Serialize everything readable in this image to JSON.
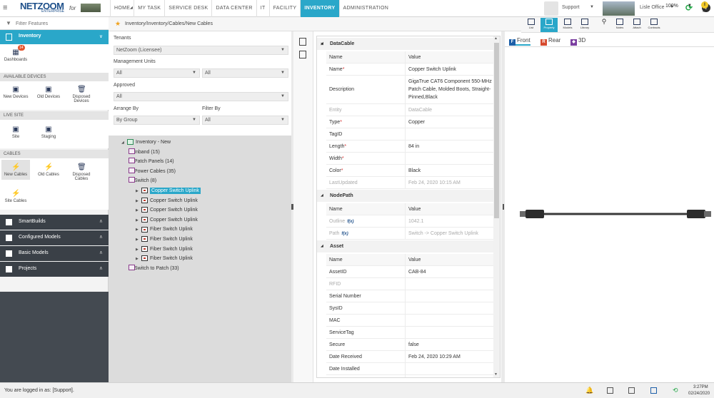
{
  "topbar": {
    "logo": "NETZOOM",
    "logo_sub": "ENTERPRISE",
    "logo_for": "for",
    "nav_tabs": [
      {
        "label": "HOME"
      },
      {
        "label": "MY TASK"
      },
      {
        "label": "SERVICE DESK"
      },
      {
        "label": "DATA CENTER"
      },
      {
        "label": "IT"
      },
      {
        "label": "FACILITY"
      },
      {
        "label": "INVENTORY"
      },
      {
        "label": "ADMINISTRATION"
      }
    ],
    "user": "Support",
    "office": "Lisle Office"
  },
  "sidebar": {
    "filter_placeholder": "Filter Features",
    "inventory_label": "Inventory",
    "dashboards_label": "Dashboards",
    "dashboards_badge": "14",
    "available_devices_title": "AVAILABLE DEVICES",
    "devices": [
      {
        "label": "New Devices"
      },
      {
        "label": "Old Devices"
      },
      {
        "label": "Disposed Devices"
      }
    ],
    "live_site_title": "LIVE SITE",
    "live_site": [
      {
        "label": "Site"
      },
      {
        "label": "Staging"
      }
    ],
    "cables_title": "CABLES",
    "cables": [
      {
        "label": "New Cables"
      },
      {
        "label": "Old Cables"
      },
      {
        "label": "Disposed Cables"
      },
      {
        "label": "Site Cables"
      }
    ],
    "modules": [
      {
        "label": "SmartBuilds"
      },
      {
        "label": "Configured Models"
      },
      {
        "label": "Basic Models"
      },
      {
        "label": "Projects"
      }
    ]
  },
  "breadcrumb": "Inventory/Inventory/Cables/New Cables",
  "toolbar": {
    "buttons": [
      {
        "label": "List"
      },
      {
        "label": "Property"
      },
      {
        "label": "Models"
      },
      {
        "label": "Library"
      },
      {
        "label": "Notes"
      },
      {
        "label": "Attach"
      },
      {
        "label": "Contracts"
      }
    ],
    "zoom": "100%",
    "info_label": "Info"
  },
  "form": {
    "tenants_label": "Tenants",
    "tenants_value": "NetZoom (Licensee)",
    "mgmt_label": "Management Units",
    "mgmt_value_1": "All",
    "mgmt_value_2": "All",
    "approved_label": "Approved",
    "approved_value": "All",
    "arrange_label": "Arrange By",
    "arrange_value": "By Group",
    "filter_label": "Filter By",
    "filter_value": "All"
  },
  "tree": [
    {
      "label": "Inventory - New",
      "indent": 0,
      "toggle": "◢",
      "kind": "root"
    },
    {
      "label": "Inband (15)",
      "indent": 1,
      "toggle": "▶",
      "kind": "grp"
    },
    {
      "label": "Patch Panels (14)",
      "indent": 1,
      "toggle": "▶",
      "kind": "grp"
    },
    {
      "label": "Power Cables (35)",
      "indent": 1,
      "toggle": "▶",
      "kind": "grp"
    },
    {
      "label": "Switch (8)",
      "indent": 1,
      "toggle": "◢",
      "kind": "grp"
    },
    {
      "label": "Copper Switch Uplink",
      "indent": 2,
      "toggle": "▶",
      "kind": "cab",
      "selected": true
    },
    {
      "label": "Copper Switch Uplink",
      "indent": 2,
      "toggle": "▶",
      "kind": "cab"
    },
    {
      "label": "Copper Switch Uplink",
      "indent": 2,
      "toggle": "▶",
      "kind": "cab"
    },
    {
      "label": "Copper Switch Uplink",
      "indent": 2,
      "toggle": "▶",
      "kind": "cab"
    },
    {
      "label": "Fiber Switch Uplink",
      "indent": 2,
      "toggle": "▶",
      "kind": "cab"
    },
    {
      "label": "Fiber Switch Uplink",
      "indent": 2,
      "toggle": "▶",
      "kind": "cab"
    },
    {
      "label": "Fiber Switch Uplink",
      "indent": 2,
      "toggle": "▶",
      "kind": "cab"
    },
    {
      "label": "Fiber Switch Uplink",
      "indent": 2,
      "toggle": "▶",
      "kind": "cab"
    },
    {
      "label": "Switch to Patch (33)",
      "indent": 1,
      "toggle": "▶",
      "kind": "grp"
    }
  ],
  "props": {
    "groups": [
      {
        "name": "DataCable",
        "rows": [
          {
            "k": "Name",
            "v": "Value",
            "hdr": true
          },
          {
            "k": "Name",
            "v": "Copper Switch Uplink",
            "req": true
          },
          {
            "k": "Description",
            "v": "GigaTrue CAT6 Component 550-MHz Patch Cable, Molded Boots, Straight-Pinned,Black",
            "tall": true
          },
          {
            "k": "Entity",
            "v": "DataCable",
            "dim": true
          },
          {
            "k": "Type",
            "v": "Copper",
            "req": true
          },
          {
            "k": "TagID",
            "v": ""
          },
          {
            "k": "Length",
            "v": "84 in",
            "req": true
          },
          {
            "k": "Width",
            "v": "",
            "req": true
          },
          {
            "k": "Color",
            "v": "Black",
            "req": true
          },
          {
            "k": "LastUpdated",
            "v": "Feb 24, 2020 10:15 AM",
            "dim": true
          }
        ]
      },
      {
        "name": "NodePath",
        "rows": [
          {
            "k": "Name",
            "v": "Value",
            "hdr": true
          },
          {
            "k": "Outline",
            "v": "1042.1",
            "dim": true,
            "fx": true
          },
          {
            "k": "Path",
            "v": "Switch -> Copper Switch Uplink",
            "dim": true,
            "fx": true
          }
        ]
      },
      {
        "name": "Asset",
        "rows": [
          {
            "k": "Name",
            "v": "Value",
            "hdr": true
          },
          {
            "k": "AssetID",
            "v": "CAB-84"
          },
          {
            "k": "RFID",
            "v": "",
            "dim": true
          },
          {
            "k": "Serial Number",
            "v": ""
          },
          {
            "k": "SysID",
            "v": ""
          },
          {
            "k": "MAC",
            "v": ""
          },
          {
            "k": "ServiceTag",
            "v": ""
          },
          {
            "k": "Secure",
            "v": "false"
          },
          {
            "k": "Date Received",
            "v": "Feb 24, 2020 10:29 AM"
          },
          {
            "k": "Date Installed",
            "v": ""
          },
          {
            "k": "Date Uninstalled",
            "v": ""
          }
        ]
      }
    ],
    "fx_label": "f(x)"
  },
  "viewer": {
    "tabs": [
      {
        "label": "Front"
      },
      {
        "label": "Rear"
      },
      {
        "label": "3D"
      }
    ]
  },
  "status": {
    "text": "You are logged in as: [Support].",
    "time": "3:27PM",
    "date": "02/24/2020"
  }
}
